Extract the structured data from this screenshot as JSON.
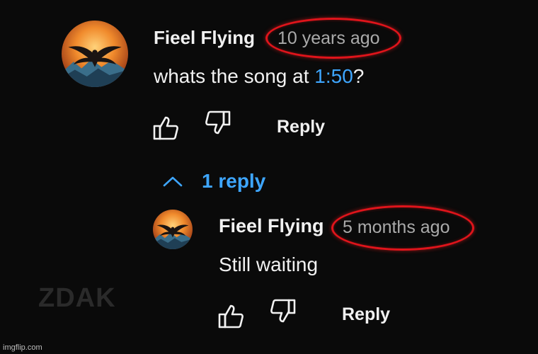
{
  "comment": {
    "author": "Fieel Flying",
    "time": "10 years ago",
    "text_before": "whats the song at ",
    "timestamp": "1:50",
    "text_after": "?",
    "reply_label": "Reply",
    "like_icon": "thumbs-up-icon",
    "dislike_icon": "thumbs-down-icon"
  },
  "replies_toggle": {
    "label": "1 reply",
    "icon": "chevron-up-icon"
  },
  "reply": {
    "author": "Fieel Flying",
    "time": "5 months ago",
    "text": "Still waiting",
    "reply_label": "Reply"
  },
  "watermark": "ZDAK",
  "site_watermark": "imgflip.com",
  "colors": {
    "background": "#0a0a0a",
    "link_blue": "#3ea6ff",
    "highlight_red": "#e0141b",
    "muted_text": "#aaaaaa"
  }
}
